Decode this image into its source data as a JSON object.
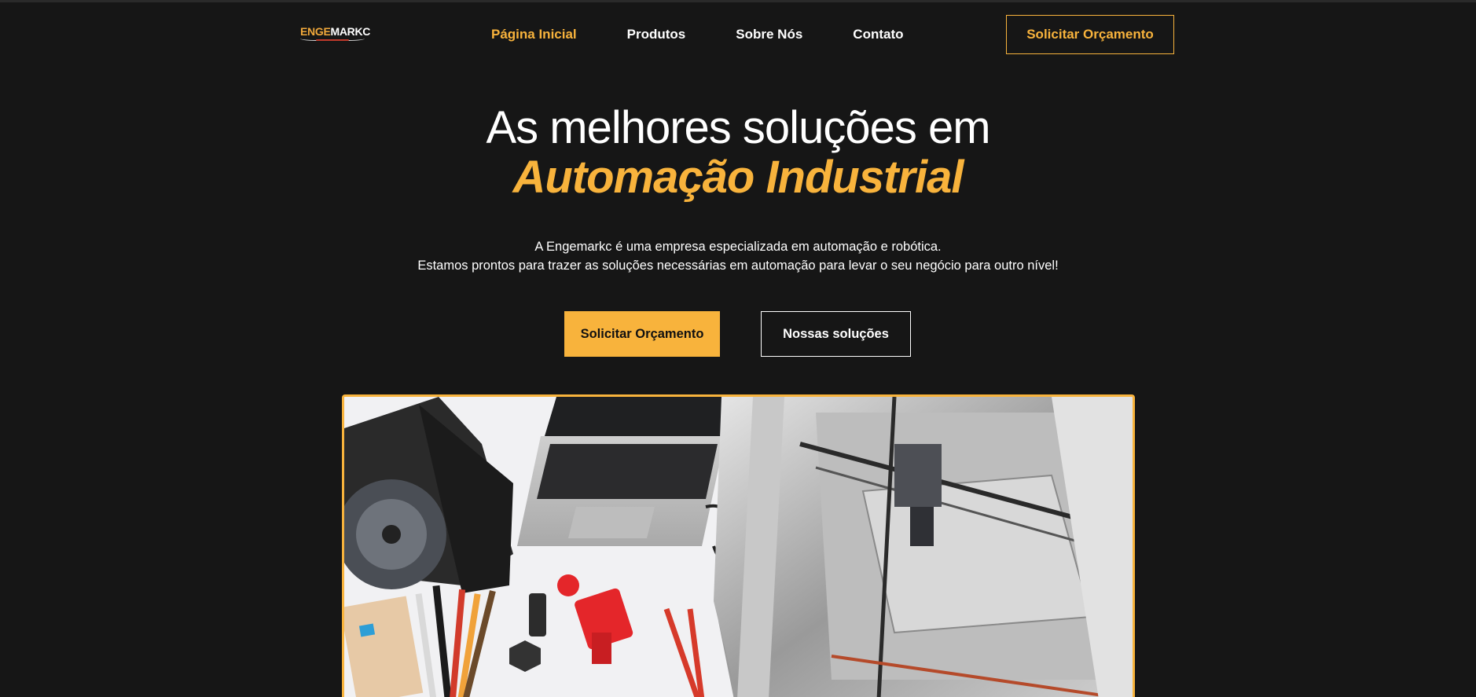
{
  "brand": {
    "logo_part1": "ENGE",
    "logo_part2": "MARKC",
    "accent_color": "#f8b33c",
    "background_color": "#161616"
  },
  "nav": {
    "items": [
      {
        "label": "Página Inicial",
        "active": true
      },
      {
        "label": "Produtos",
        "active": false
      },
      {
        "label": "Sobre Nós",
        "active": false
      },
      {
        "label": "Contato",
        "active": false
      }
    ],
    "cta_label": "Solicitar Orçamento"
  },
  "hero": {
    "title_line1": "As melhores soluções em",
    "title_line2": "Automação Industrial",
    "description_line1": "A Engemarkc é uma empresa especializada em automação e robótica.",
    "description_line2": "Estamos prontos para trazer as soluções necessárias em automação para levar o seu negócio para outro nível!",
    "primary_button": "Solicitar Orçamento",
    "secondary_button": "Nossas soluções"
  },
  "hero_image": {
    "subject": "desk with laptop, 3D printer, turbine model, pencils, pliers and red 3D-printed part"
  },
  "icons": [
    "laptop-icon",
    "3d-printer-icon",
    "turbine-icon"
  ]
}
